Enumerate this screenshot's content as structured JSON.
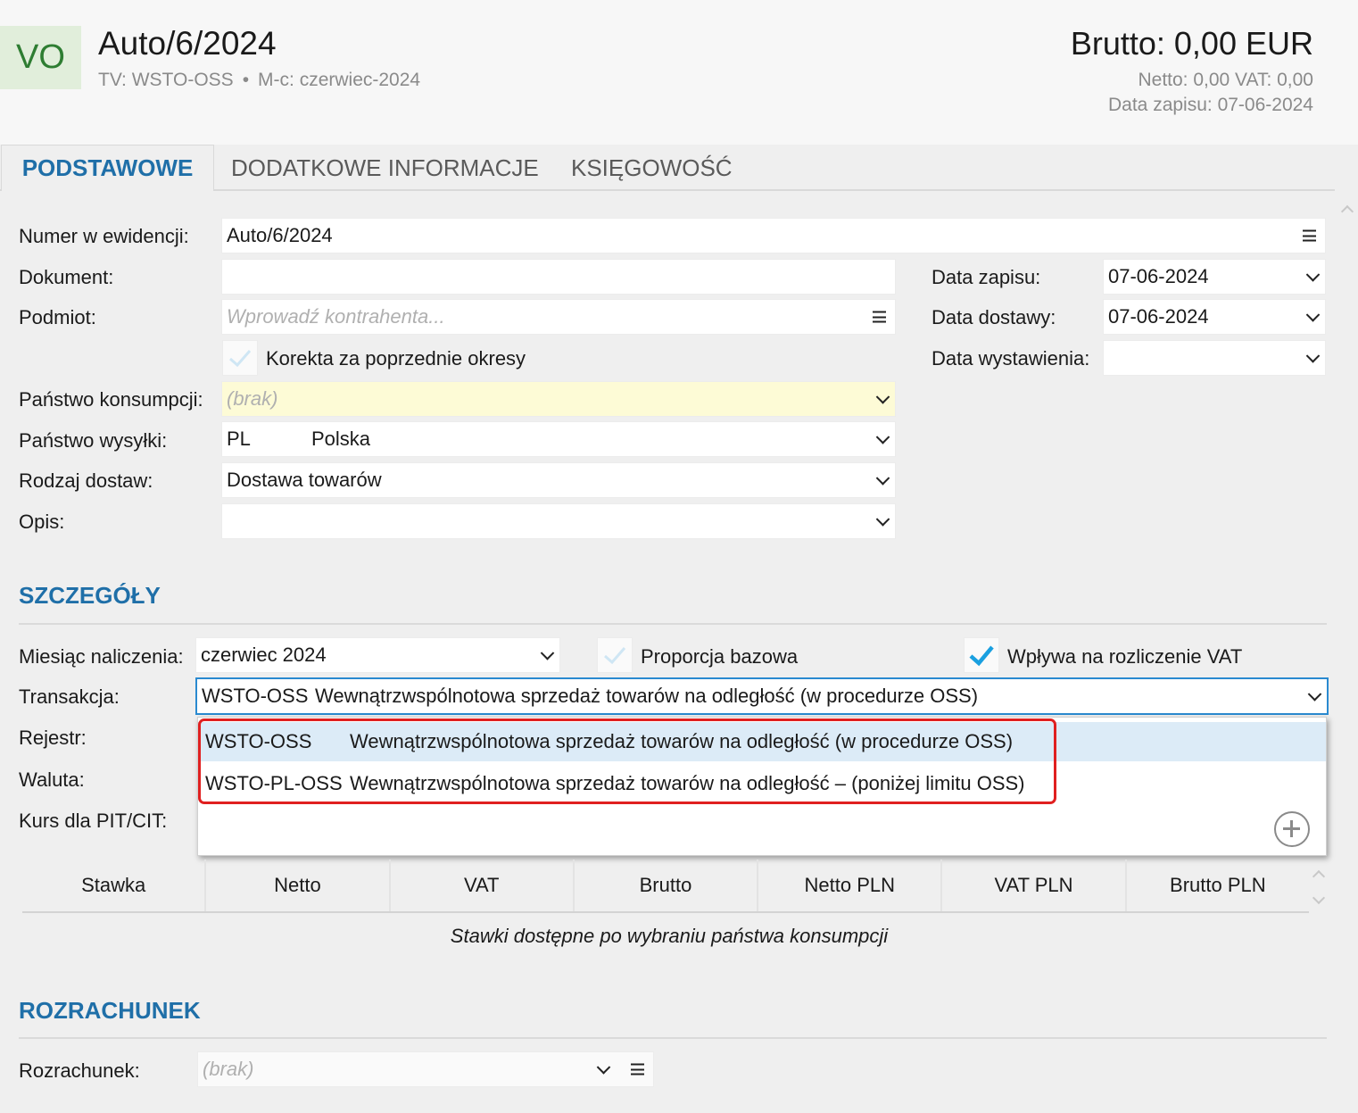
{
  "header": {
    "badge": "VO",
    "title": "Auto/6/2024",
    "tv_label": "TV: WSTO-OSS",
    "separator": "•",
    "month_label": "M-c: czerwiec-2024",
    "brutto": "Brutto: 0,00 EUR",
    "netto_vat": "Netto: 0,00 VAT: 0,00",
    "data_zapisu": "Data zapisu: 07-06-2024"
  },
  "tabs": [
    {
      "label": "PODSTAWOWE"
    },
    {
      "label": "DODATKOWE INFORMACJE"
    },
    {
      "label": "KSIĘGOWOŚĆ"
    }
  ],
  "form": {
    "numer_label": "Numer w ewidencji:",
    "numer_value": "Auto/6/2024",
    "dokument_label": "Dokument:",
    "dokument_value": "",
    "podmiot_label": "Podmiot:",
    "podmiot_placeholder": "Wprowadź kontrahenta...",
    "korekta_label": "Korekta za poprzednie okresy",
    "korekta_checked": false,
    "panstwo_konsumpcji_label": "Państwo konsumpcji:",
    "panstwo_konsumpcji_value": "(brak)",
    "panstwo_wysylki_label": "Państwo wysyłki:",
    "panstwo_wysylki_code": "PL",
    "panstwo_wysylki_name": "Polska",
    "rodzaj_label": "Rodzaj dostaw:",
    "rodzaj_value": "Dostawa towarów",
    "opis_label": "Opis:",
    "opis_value": "",
    "data_zapisu_label": "Data zapisu:",
    "data_zapisu_value": "07-06-2024",
    "data_dostawy_label": "Data dostawy:",
    "data_dostawy_value": "07-06-2024",
    "data_wystawienia_label": "Data wystawienia:",
    "data_wystawienia_value": ""
  },
  "szczegoly": {
    "title": "SZCZEGÓŁY",
    "miesiac_label": "Miesiąc naliczenia:",
    "miesiac_value": "czerwiec 2024",
    "proporcja_label": "Proporcja bazowa",
    "proporcja_checked": false,
    "wplywa_label": "Wpływa na rozliczenie VAT",
    "wplywa_checked": true,
    "transakcja_label": "Transakcja:",
    "transakcja_code": "WSTO-OSS",
    "transakcja_desc": "Wewnątrzwspólnotowa sprzedaż towarów na odległość (w procedurze OSS)",
    "rejestr_label": "Rejestr:",
    "waluta_label": "Waluta:",
    "kurs_label": "Kurs dla PIT/CIT:",
    "dropdown_options": [
      {
        "code": "WSTO-OSS",
        "desc": "Wewnątrzwspólnotowa sprzedaż towarów na odległość (w procedurze OSS)"
      },
      {
        "code": "WSTO-PL-OSS",
        "desc": "Wewnątrzwspólnotowa sprzedaż towarów na odległość – (poniżej limitu OSS)"
      }
    ]
  },
  "rates_table": {
    "columns": [
      "Stawka",
      "Netto",
      "VAT",
      "Brutto",
      "Netto PLN",
      "VAT PLN",
      "Brutto PLN"
    ],
    "empty_note": "Stawki dostępne po wybraniu państwa konsumpcji"
  },
  "rozrachunek": {
    "title": "ROZRACHUNEK",
    "label": "Rozrachunek:",
    "value": "(brak)"
  },
  "colors": {
    "accent": "#1f6fa8",
    "focus_border": "#2a8ad0",
    "highlight_frame": "#e02020",
    "badge_bg": "#e1eedb",
    "badge_text": "#2e7d32",
    "check": "#1aa0e0"
  }
}
